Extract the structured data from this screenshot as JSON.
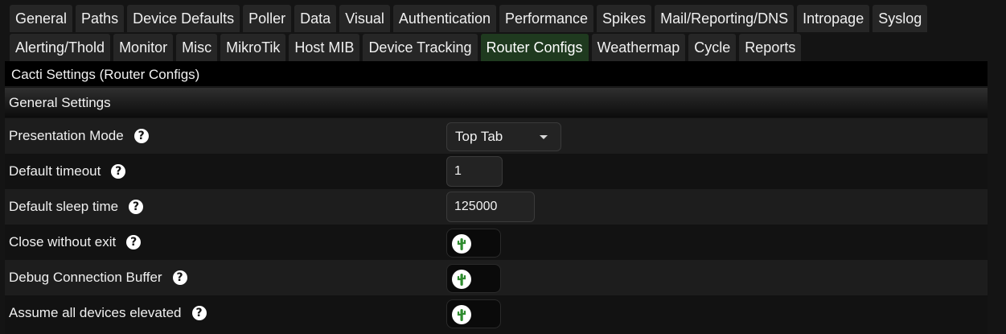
{
  "tabs": {
    "row1": [
      {
        "label": "General",
        "selected": false
      },
      {
        "label": "Paths",
        "selected": false
      },
      {
        "label": "Device Defaults",
        "selected": false
      },
      {
        "label": "Poller",
        "selected": false
      },
      {
        "label": "Data",
        "selected": false
      },
      {
        "label": "Visual",
        "selected": false
      },
      {
        "label": "Authentication",
        "selected": false
      },
      {
        "label": "Performance",
        "selected": false
      },
      {
        "label": "Spikes",
        "selected": false
      },
      {
        "label": "Mail/Reporting/DNS",
        "selected": false
      },
      {
        "label": "Intropage",
        "selected": false
      },
      {
        "label": "Syslog",
        "selected": false
      }
    ],
    "row2": [
      {
        "label": "Alerting/Thold",
        "selected": false
      },
      {
        "label": "Monitor",
        "selected": false
      },
      {
        "label": "Misc",
        "selected": false
      },
      {
        "label": "MikroTik",
        "selected": false
      },
      {
        "label": "Host MIB",
        "selected": false
      },
      {
        "label": "Device Tracking",
        "selected": false
      },
      {
        "label": "Router Configs",
        "selected": true
      },
      {
        "label": "Weathermap",
        "selected": false
      },
      {
        "label": "Cycle",
        "selected": false
      },
      {
        "label": "Reports",
        "selected": false
      }
    ]
  },
  "page_title": "Cacti Settings (Router Configs)",
  "section": {
    "title": "General Settings"
  },
  "settings": [
    {
      "label": "Presentation Mode",
      "help": "?",
      "type": "select",
      "value": "Top Tab"
    },
    {
      "label": "Default timeout",
      "help": "?",
      "type": "text",
      "value": "1"
    },
    {
      "label": "Default sleep time",
      "help": "?",
      "type": "text",
      "value": "125000"
    },
    {
      "label": "Close without exit",
      "help": "?",
      "type": "toggle",
      "value": "off",
      "icon": "cactus-icon"
    },
    {
      "label": "Debug Connection Buffer",
      "help": "?",
      "type": "toggle",
      "value": "off",
      "icon": "cactus-icon"
    },
    {
      "label": "Assume all devices elevated",
      "help": "?",
      "type": "toggle",
      "value": "off",
      "icon": "cactus-icon"
    }
  ],
  "colors": {
    "background": "#141414",
    "tab": "#262626",
    "tab_selected": "#1f3a1f",
    "cactus": "#2e8b2e"
  }
}
